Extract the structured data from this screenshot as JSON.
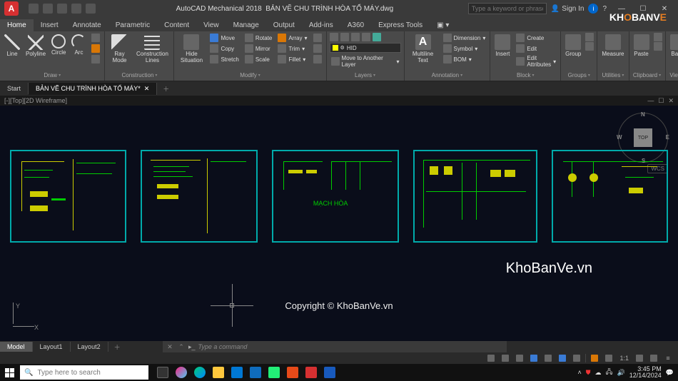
{
  "app": {
    "suite": "AutoCAD Mechanical 2018",
    "file": "BẢN VẼ CHU TRÌNH HÒA TỔ MÁY.dwg",
    "sign_in": "Sign In",
    "search_placeholder": "Type a keyword or phrase"
  },
  "ribbon_tabs": [
    "Home",
    "Insert",
    "Annotate",
    "Parametric",
    "Content",
    "View",
    "Manage",
    "Output",
    "Add-ins",
    "A360",
    "Express Tools"
  ],
  "ribbon": {
    "draw": {
      "label": "Draw",
      "items": [
        "Line",
        "Polyline",
        "Circle",
        "Arc"
      ]
    },
    "construction": {
      "label": "Construction",
      "items": [
        "Ray Mode",
        "Construction Lines"
      ]
    },
    "modify": {
      "label": "Modify",
      "hide": "Hide Situation",
      "rows": [
        [
          "Move",
          "Rotate",
          "Array"
        ],
        [
          "Copy",
          "Mirror",
          "Trim"
        ],
        [
          "Stretch",
          "Scale",
          "Fillet"
        ]
      ]
    },
    "layers": {
      "label": "Layers",
      "current": "HID",
      "link": "Move to Another Layer"
    },
    "annotation": {
      "label": "Annotation",
      "multiline": "Multiline Text",
      "rows": [
        "Dimension",
        "Symbol",
        "BOM"
      ]
    },
    "block": {
      "label": "Block",
      "insert": "Insert",
      "rows": [
        "Create",
        "Edit",
        "Edit Attributes"
      ]
    },
    "groups": {
      "label": "Groups",
      "item": "Group"
    },
    "utilities": {
      "label": "Utilities",
      "item": "Measure"
    },
    "clipboard": {
      "label": "Clipboard",
      "item": "Paste"
    },
    "view": {
      "label": "View",
      "item": "Base"
    }
  },
  "file_tabs": {
    "start": "Start",
    "active": "BẢN VẼ CHU TRÌNH HÒA TỔ MÁY*"
  },
  "viewport": {
    "label": "[-][Top][2D Wireframe]",
    "cube_face": "TOP",
    "wcs": "WCS",
    "dirs": {
      "n": "N",
      "s": "S",
      "e": "E",
      "w": "W"
    }
  },
  "drawing": {
    "sheet3_label": "MẠCH HÒA"
  },
  "ucs": {
    "x": "X",
    "y": "Y"
  },
  "watermark": "KhoBanVe.vn",
  "copyright": "Copyright © KhoBanVe.vn",
  "brand": {
    "part1": "KH",
    "o1": "O",
    "part2": "BANV",
    "o2": "E"
  },
  "model_tabs": [
    "Model",
    "Layout1",
    "Layout2"
  ],
  "cmdline": {
    "prompt": "Type a command"
  },
  "status": {
    "scale": "1:1"
  },
  "taskbar": {
    "search": "Type here to search",
    "time": "3:45 PM",
    "date": "12/14/2024"
  }
}
